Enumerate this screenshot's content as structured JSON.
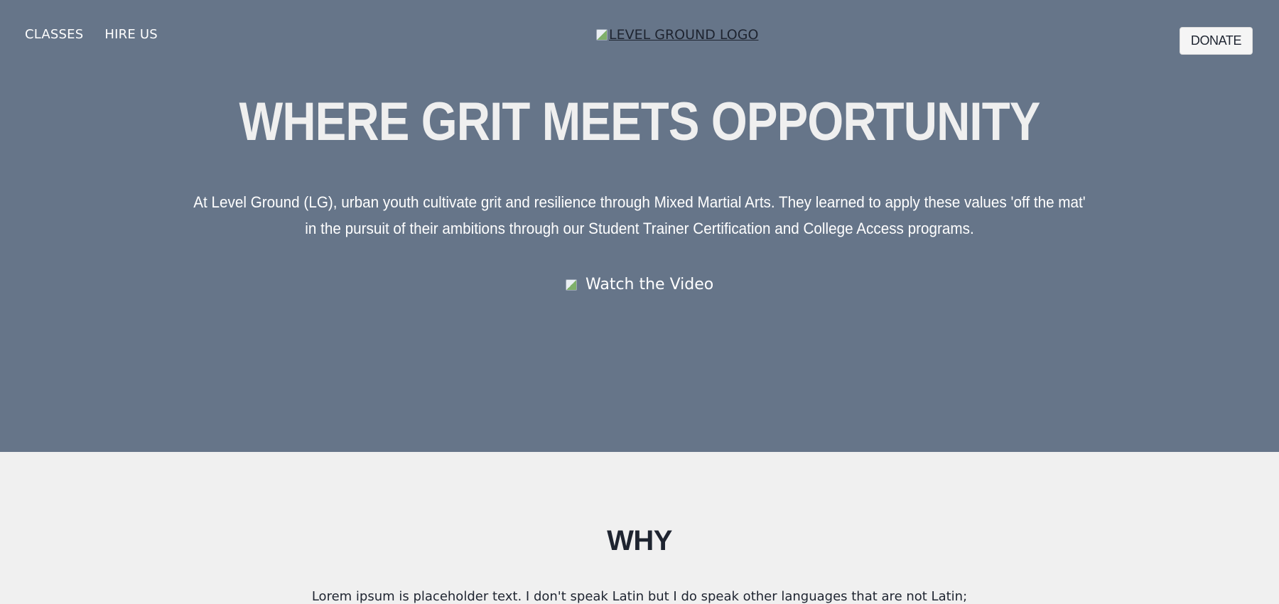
{
  "nav": {
    "links": [
      "CLASSES",
      "HIRE US"
    ],
    "logo_alt": "LEVEL GROUND LOGO",
    "donate_label": "DONATE"
  },
  "hero": {
    "headline": "WHERE GRIT MEETS OPPORTUNITY",
    "intro": "At Level Ground (LG), urban youth cultivate grit and resilience through Mixed Martial Arts. They learned to apply these values 'off the mat' in the pursuit of their ambitions through our Student Trainer Certification and College Access programs.",
    "video_label": "Watch the Video",
    "background_color": "#667589"
  },
  "why": {
    "title": "WHY",
    "text": "Lorem ipsum is placeholder text. I don't speak Latin but I do speak other languages that are not Latin;"
  }
}
